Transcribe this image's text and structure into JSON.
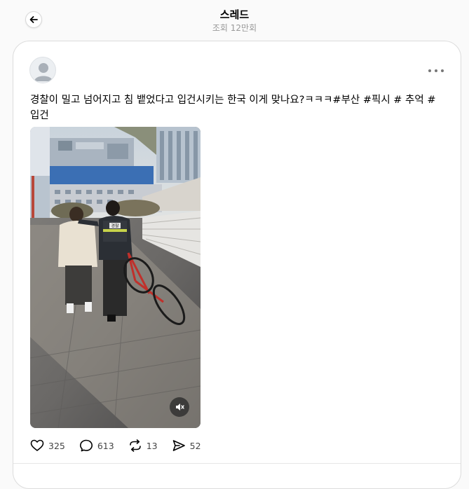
{
  "header": {
    "title": "스레드",
    "views": "조회 12만회"
  },
  "post": {
    "text": "경찰이 밀고 넘어지고 침 뱉었다고 입건시키는 한국 이게 맞나요?ㅋㅋㅋ#부산 #픽시 # 추억 #입건",
    "media": {
      "vest_label": "경찰",
      "muted": true
    },
    "stats": {
      "likes": "325",
      "comments": "613",
      "reposts": "13",
      "shares": "52"
    }
  }
}
